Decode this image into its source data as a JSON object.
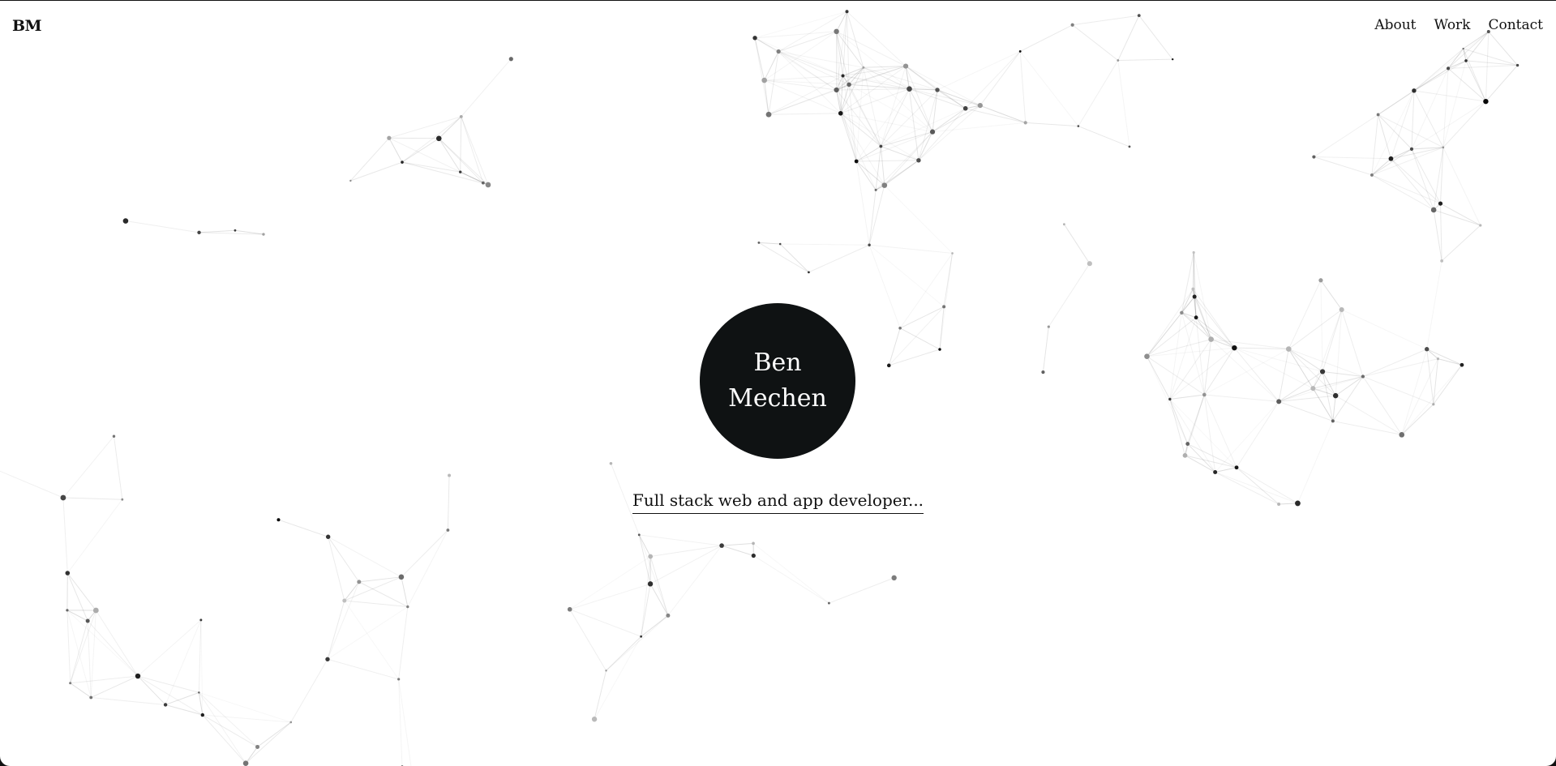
{
  "header": {
    "logo": "BM",
    "nav": [
      {
        "label": "About"
      },
      {
        "label": "Work"
      },
      {
        "label": "Contact"
      }
    ]
  },
  "hero": {
    "name_line1": "Ben",
    "name_line2": "Mechen",
    "tagline": "Full stack web and app developer..."
  },
  "colors": {
    "circle": "#0f1213",
    "text": "#111111",
    "line": "#d8d8d8"
  }
}
